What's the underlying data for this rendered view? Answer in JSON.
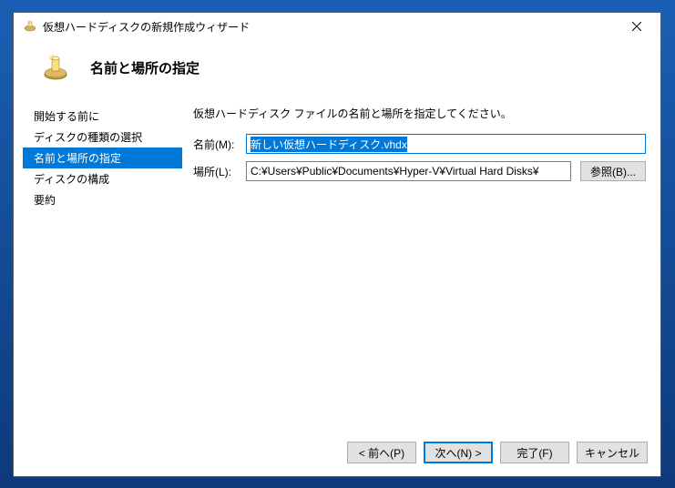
{
  "window": {
    "title": "仮想ハードディスクの新規作成ウィザード"
  },
  "header": {
    "title": "名前と場所の指定"
  },
  "sidebar": {
    "items": [
      {
        "label": "開始する前に"
      },
      {
        "label": "ディスクの種類の選択"
      },
      {
        "label": "名前と場所の指定"
      },
      {
        "label": "ディスクの構成"
      },
      {
        "label": "要約"
      }
    ],
    "activeIndex": 2
  },
  "main": {
    "instruction": "仮想ハードディスク ファイルの名前と場所を指定してください。",
    "nameLabel": "名前(M):",
    "nameValue": "新しい仮想ハードディスク.vhdx",
    "locationLabel": "場所(L):",
    "locationValue": "C:¥Users¥Public¥Documents¥Hyper-V¥Virtual Hard Disks¥",
    "browseLabel": "参照(B)..."
  },
  "buttons": {
    "back": "< 前へ(P)",
    "next": "次へ(N) >",
    "finish": "完了(F)",
    "cancel": "キャンセル"
  }
}
